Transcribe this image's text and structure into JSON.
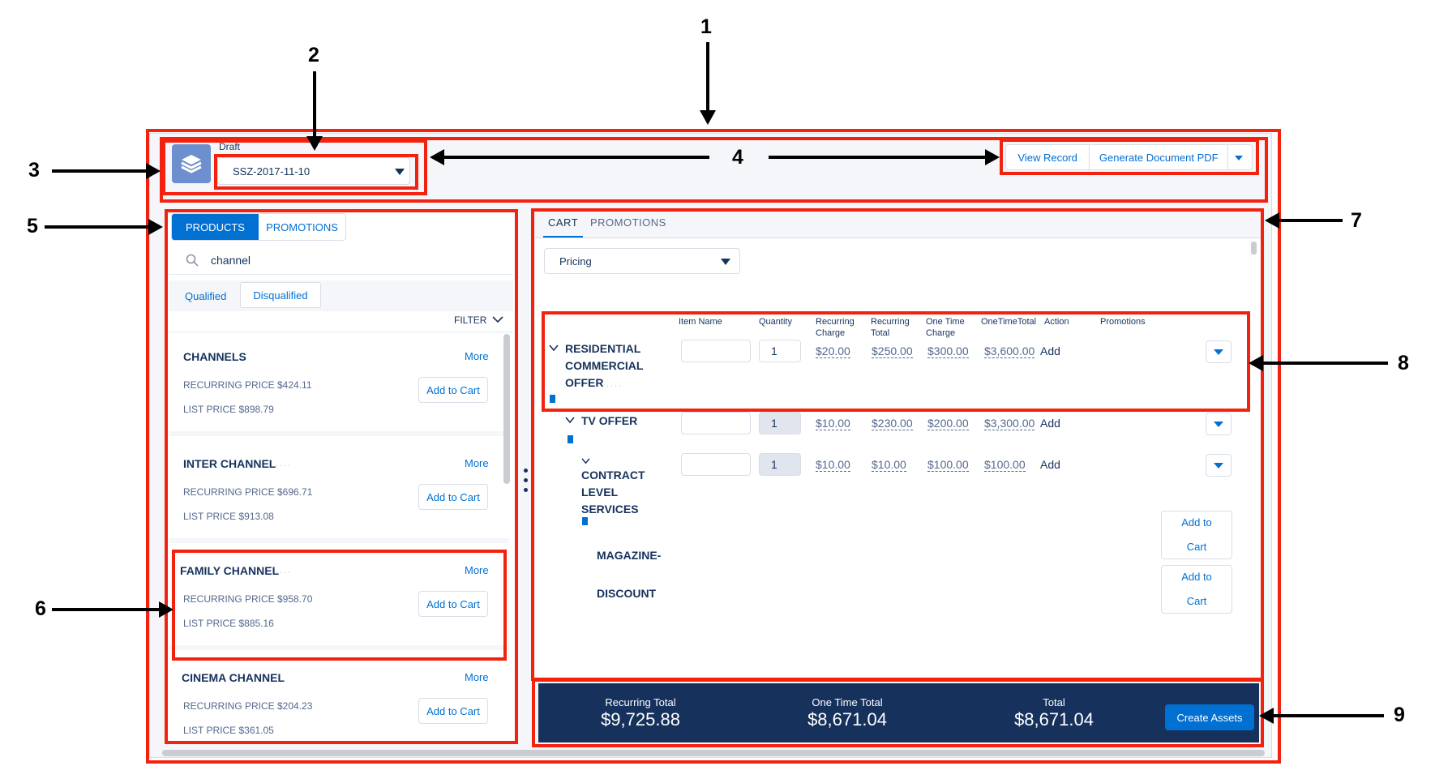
{
  "callouts": [
    "1",
    "2",
    "3",
    "4",
    "5",
    "6",
    "7",
    "8",
    "9"
  ],
  "header": {
    "status": "Draft",
    "quote_select": "SSZ-2017-11-10",
    "view_record": "View Record",
    "generate_pdf": "Generate Document PDF",
    "logo_icon": "layers-icon"
  },
  "left_panel": {
    "tabs": [
      "PRODUCTS",
      "PROMOTIONS"
    ],
    "search_value": "channel",
    "filter_tabs": [
      "Qualified",
      "Disqualified"
    ],
    "filter_label": "FILTER",
    "products": [
      {
        "name": "CHANNELS",
        "more": "More",
        "recurring": "RECURRING PRICE $424.11",
        "list": "LIST PRICE $898.79",
        "button": "Add to Cart"
      },
      {
        "name": "INTER CHANNEL",
        "more": "More",
        "recurring": "RECURRING PRICE $696.71",
        "list": "LIST PRICE $913.08",
        "button": "Add to Cart"
      },
      {
        "name": "FAMILY CHANNEL",
        "more": "More",
        "recurring": "RECURRING PRICE $958.70",
        "list": "LIST PRICE $885.16",
        "button": "Add to Cart"
      },
      {
        "name": "CINEMA CHANNEL",
        "more": "More",
        "recurring": "RECURRING PRICE $204.23",
        "list": "LIST PRICE $361.05",
        "button": "Add to Cart"
      }
    ]
  },
  "cart": {
    "tabs": [
      "CART",
      "PROMOTIONS"
    ],
    "view_select": "Pricing",
    "columns": [
      "Item Name",
      "Quantity",
      "Recurring Charge",
      "Recurring Total",
      "One Time Charge",
      "OneTimeTotal",
      "Action",
      "Promotions"
    ],
    "rows": [
      {
        "name_lines": [
          "RESIDENTIAL",
          "COMMERCIAL",
          "OFFER"
        ],
        "qty": "1",
        "recurring_charge": "$20.00",
        "recurring_total": "$250.00",
        "one_time_charge": "$300.00",
        "one_time_total": "$3,600.00",
        "action": "Add"
      },
      {
        "name_lines": [
          "TV OFFER"
        ],
        "qty": "1",
        "recurring_charge": "$10.00",
        "recurring_total": "$230.00",
        "one_time_charge": "$200.00",
        "one_time_total": "$3,300.00",
        "action": "Add"
      },
      {
        "name_lines": [
          "CONTRACT",
          "LEVEL",
          "SERVICES"
        ],
        "qty": "1",
        "recurring_charge": "$10.00",
        "recurring_total": "$10.00",
        "one_time_charge": "$100.00",
        "one_time_total": "$100.00",
        "action": "Add"
      }
    ],
    "promotions": [
      {
        "name": "MAGAZINE-",
        "button_lines": [
          "Add to",
          "Cart"
        ]
      },
      {
        "name": "DISCOUNT",
        "button_lines": [
          "Add to",
          "Cart"
        ]
      }
    ]
  },
  "footer": {
    "recurring_label": "Recurring Total",
    "recurring_value": "$9,725.88",
    "one_time_label": "One Time Total",
    "one_time_value": "$8,671.04",
    "total_label": "Total",
    "total_value": "$8,671.04",
    "create_assets": "Create Assets"
  },
  "colors": {
    "annotation_red": "#f3220f",
    "brand_blue": "#0070d2",
    "footer_navy": "#16325c",
    "logo_blue": "#6d8fce"
  }
}
